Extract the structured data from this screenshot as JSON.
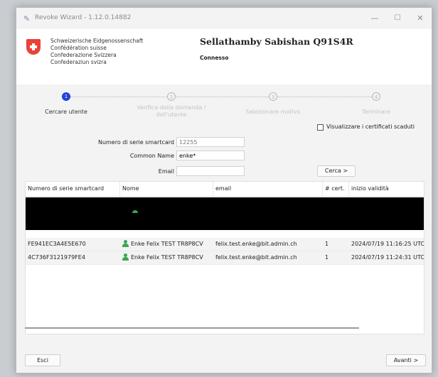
{
  "window": {
    "title": "Revoke Wizard - 1.12.0.14882",
    "controls": {
      "minimize": "—",
      "maximize": "☐",
      "close": "✕"
    }
  },
  "header": {
    "confederation": [
      "Schweizerische Eidgenossenschaft",
      "Confédération suisse",
      "Confederazione Svizzera",
      "Confederaziun svizra"
    ],
    "user_name": "Sellathamby Sabishan Q91S4R",
    "status": "Connesso"
  },
  "steps": [
    {
      "number": "1",
      "label": "Cercare utente",
      "active": true
    },
    {
      "number": "2",
      "label_lines": [
        "Verifica della domanda /",
        "dell'utente"
      ],
      "active": false
    },
    {
      "number": "3",
      "label": "Selezionare motivo",
      "active": false
    },
    {
      "number": "4",
      "label": "Terminare",
      "active": false
    }
  ],
  "options": {
    "show_expired_label": "Visualizzare i certificati scaduti",
    "show_expired_checked": false
  },
  "search": {
    "serial_label": "Numero di serie smartcard",
    "serial_placeholder": "12255",
    "common_name_label": "Common Name",
    "common_name_value": "enke*",
    "email_label": "Email",
    "email_value": "",
    "search_button": "Cerca >"
  },
  "table": {
    "columns": [
      "Numero di serie smartcard",
      "Nome",
      "email",
      "# cert.",
      "inizio validità"
    ],
    "rows": [
      {
        "serial": "FE941EC3A4E5E670",
        "name": "Enke Felix TEST TR8P8CV",
        "email": "felix.test.enke@bit.admin.ch",
        "certs": "1",
        "start": "2024/07/19 11:16:25 UTC"
      },
      {
        "serial": "4C736F3121979FE4",
        "name": "Enke Felix TEST TR8P8CV",
        "email": "felix.test.enke@bit.admin.ch",
        "certs": "1",
        "start": "2024/07/19 11:24:31 UTC"
      }
    ]
  },
  "footer": {
    "exit_button": "Esci",
    "next_button": "Avanti >"
  },
  "colors": {
    "accent": "#1f40e0",
    "person_icon": "#3aa657",
    "swiss_red": "#e8423a"
  }
}
